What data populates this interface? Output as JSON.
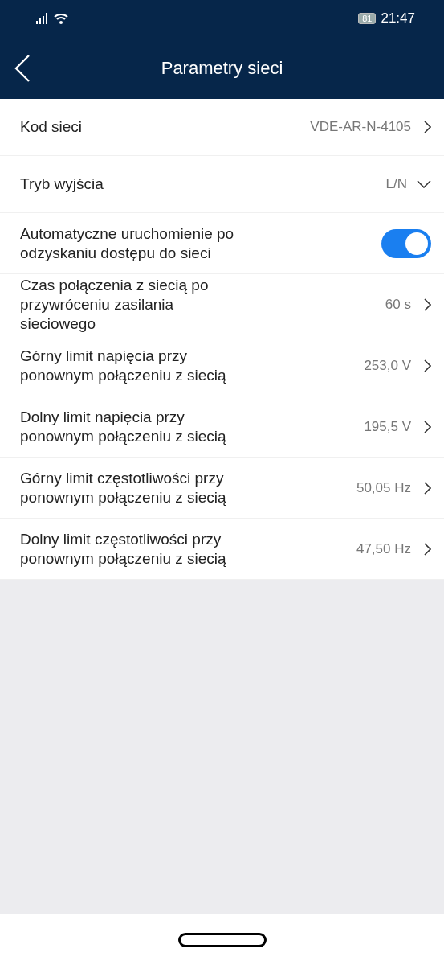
{
  "status_bar": {
    "battery": "81",
    "time": "21:47"
  },
  "header": {
    "title": "Parametry sieci"
  },
  "settings": [
    {
      "kind": "link",
      "label": "Kod sieci",
      "value": "VDE-AR-N-4105"
    },
    {
      "kind": "dropdown",
      "label": "Tryb wyjścia",
      "value": "L/N"
    },
    {
      "kind": "toggle",
      "label": "Automatyczne uruchomienie po odzyskaniu dostępu do sieci",
      "on": true
    },
    {
      "kind": "link",
      "label": "Czas połączenia z siecią po przywróceniu zasilania sieciowego",
      "value": "60 s"
    },
    {
      "kind": "link",
      "label": "Górny limit napięcia przy ponownym połączeniu z siecią",
      "value": "253,0 V"
    },
    {
      "kind": "link",
      "label": "Dolny limit napięcia przy ponownym połączeniu z siecią",
      "value": "195,5 V"
    },
    {
      "kind": "link",
      "label": "Górny limit częstotliwości przy ponownym połączeniu z siecią",
      "value": "50,05 Hz"
    },
    {
      "kind": "link",
      "label": "Dolny limit częstotliwości przy ponownym połączeniu z siecią",
      "value": "47,50 Hz"
    }
  ]
}
